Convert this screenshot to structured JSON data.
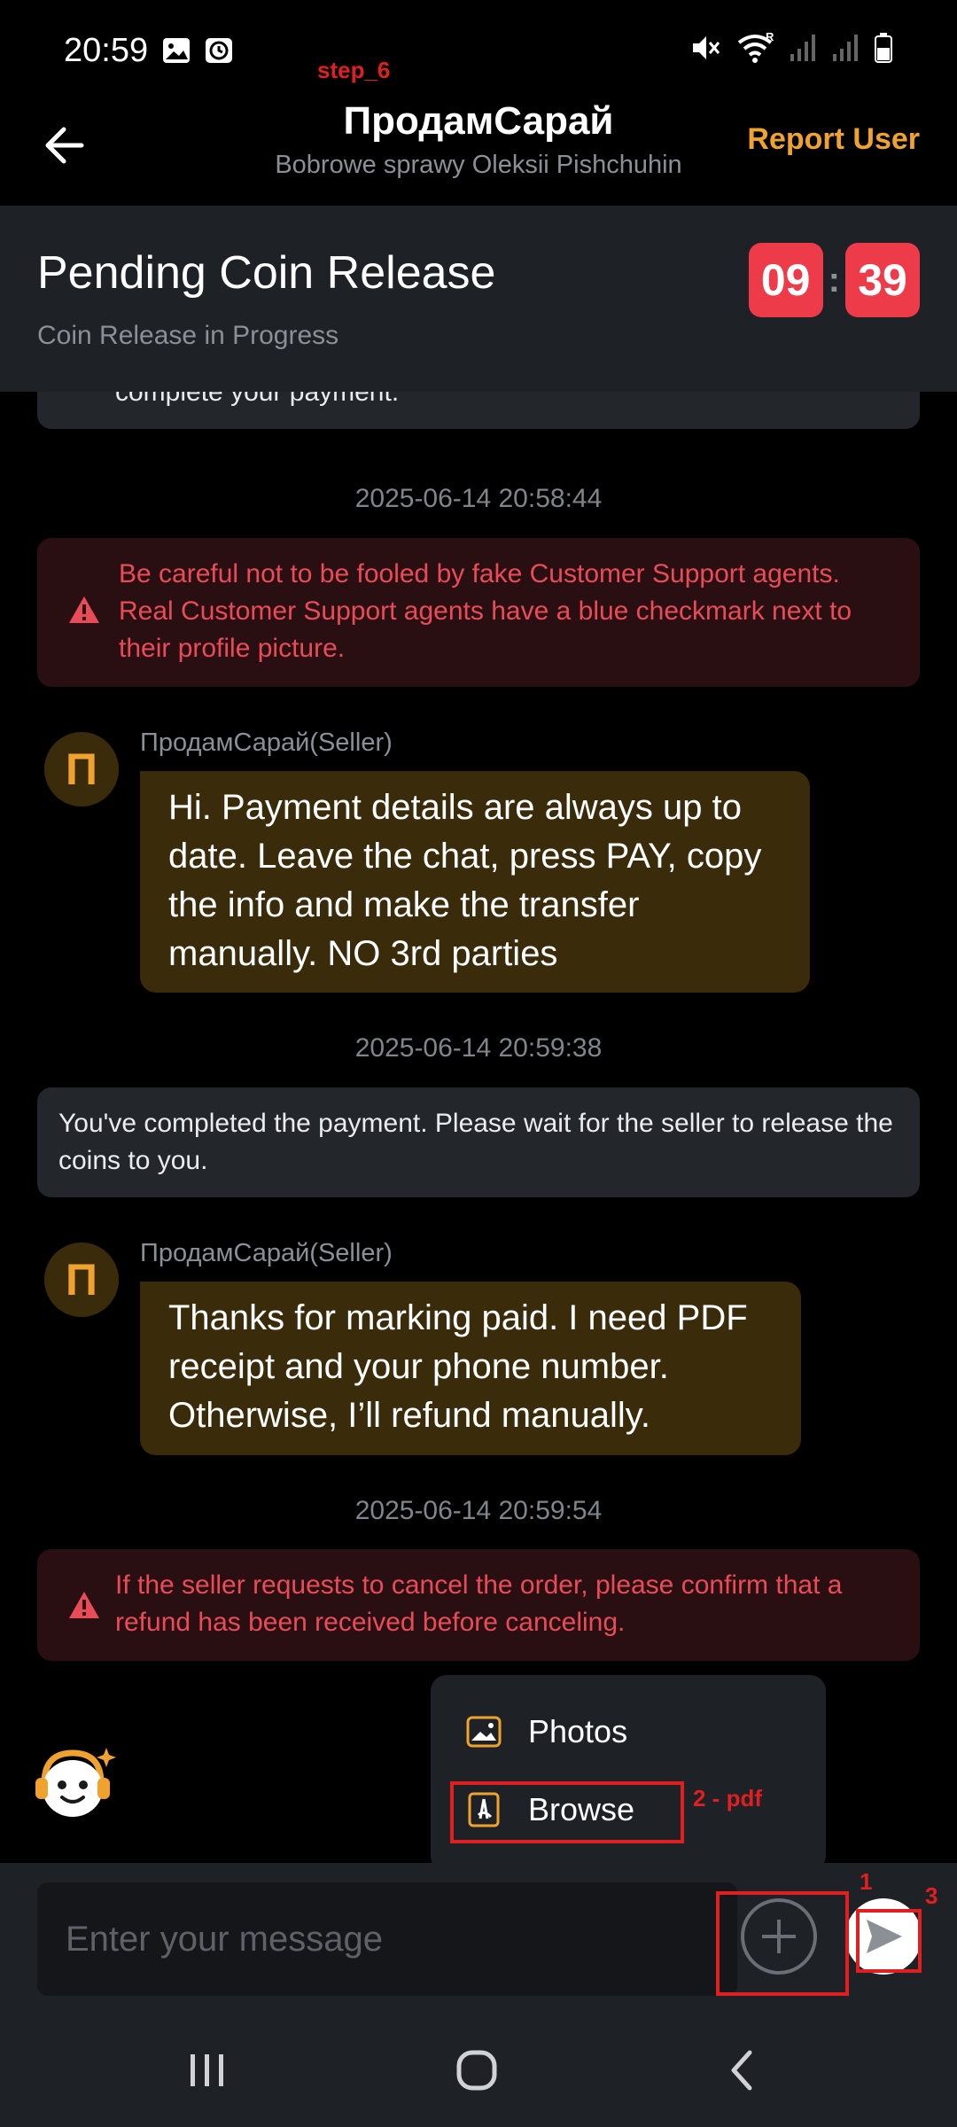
{
  "status_bar": {
    "time": "20:59",
    "icons_left": [
      "image-icon",
      "clock-icon"
    ],
    "icons_right": [
      "mute-icon",
      "wifi-icon",
      "signal-icon",
      "signal-icon",
      "battery-icon"
    ],
    "wifi_badge": "R"
  },
  "annotations": {
    "step": "step_6",
    "browse_note": "2 - pdf",
    "plus_note": "1",
    "send_note": "3",
    "color": "#e02020"
  },
  "header": {
    "title": "ПродамСарай",
    "subtitle": "Bobrowe sprawy Oleksii Pishchuhin",
    "report": "Report User"
  },
  "order": {
    "title": "Pending Coin Release",
    "status": "Coin Release in Progress",
    "timer_min": "09",
    "timer_sep": ":",
    "timer_sec": "39"
  },
  "chat": {
    "top_card_tail": "complete your payment.",
    "stamp1": "2025-06-14 20:58:44",
    "warning1": "Be careful not to be fooled by fake Customer Support agents. Real Customer Support agents have a blue checkmark next to their profile picture.",
    "avatar_letter": "П",
    "sender1": "ПродамСарай(Seller)",
    "message1": "Hi. Payment details are always up to date. Leave the chat, press PAY, copy the info and make the transfer manually. NO 3rd parties",
    "stamp2": "2025-06-14 20:59:38",
    "system2": "You've completed the payment. Please wait for the seller to release the coins to you.",
    "sender2": "ПродамСарай(Seller)",
    "message2": "Thanks for marking paid. I need PDF receipt and your phone number. Otherwise, I’ll refund manually.",
    "stamp3": "2025-06-14 20:59:54",
    "warning2": "If the seller requests to cancel the order, please confirm that a refund has been received before canceling."
  },
  "menu": {
    "photos": "Photos",
    "browse": "Browse"
  },
  "input": {
    "placeholder": "Enter your message"
  },
  "colors": {
    "accent": "#f0a22e",
    "timer": "#ee3b4a",
    "warning": "#ea4b59"
  }
}
